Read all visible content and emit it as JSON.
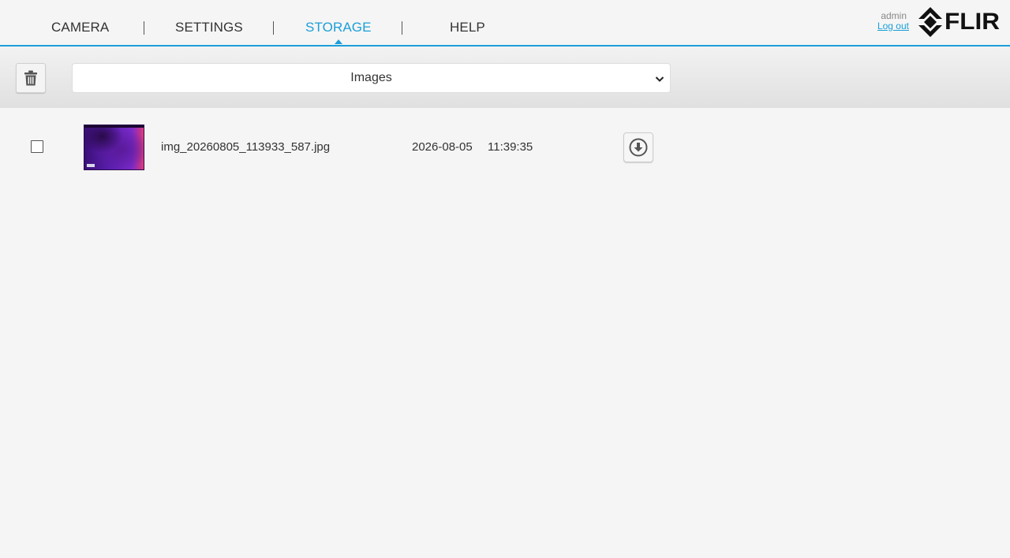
{
  "nav": {
    "items": [
      {
        "label": "CAMERA",
        "active": false
      },
      {
        "label": "SETTINGS",
        "active": false
      },
      {
        "label": "STORAGE",
        "active": true
      },
      {
        "label": "HELP",
        "active": false
      }
    ]
  },
  "user": {
    "name": "admin",
    "logout_label": "Log out"
  },
  "brand": {
    "logo_text": "FLIR",
    "icon": "flir-logo-icon"
  },
  "toolbar": {
    "delete_icon": "trash-icon",
    "filter_select": {
      "value": "Images",
      "icon": "chevron-down-icon"
    }
  },
  "files": [
    {
      "name": "img_20260805_113933_587.jpg",
      "date": "2026-08-05",
      "time": "11:39:35",
      "checked": false,
      "download_icon": "download-circle-icon"
    }
  ],
  "colors": {
    "accent": "#1a9fd9",
    "background": "#f5f5f5",
    "text": "#333333"
  }
}
